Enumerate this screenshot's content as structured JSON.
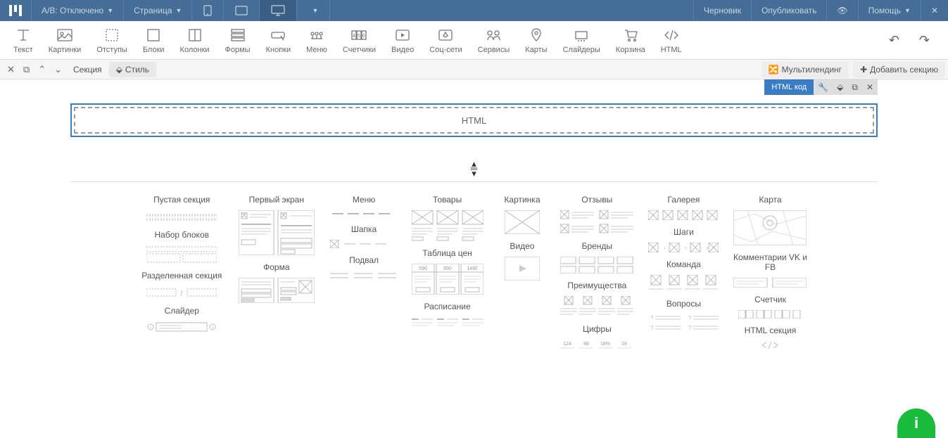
{
  "topbar": {
    "ab_label": "A/B: Отключено",
    "page_label": "Страница",
    "draft_label": "Черновик",
    "publish_label": "Опубликовать",
    "help_label": "Помощь"
  },
  "toolbar": {
    "text": "Текст",
    "images": "Картинки",
    "padding": "Отступы",
    "blocks": "Блоки",
    "columns": "Колонки",
    "forms": "Формы",
    "buttons": "Кнопки",
    "menu": "Меню",
    "counters": "Счетчики",
    "video": "Видео",
    "social": "Соц-сети",
    "services": "Сервисы",
    "maps": "Карты",
    "sliders": "Слайдеры",
    "cart": "Корзина",
    "html": "HTML"
  },
  "sectionbar": {
    "section": "Секция",
    "style": "Стиль",
    "multi": "Мультилендинг",
    "add": "Добавить секцию"
  },
  "element": {
    "badge": "HTML код",
    "placeholder": "HTML"
  },
  "templates": {
    "col1": [
      "Пустая секция",
      "Набор блоков",
      "Разделенная секция",
      "Слайдер"
    ],
    "col2": [
      "Первый экран",
      "Форма"
    ],
    "col3": [
      "Меню",
      "Шапка",
      "Подвал"
    ],
    "col4": [
      "Товары",
      "Таблица цен",
      "Расписание"
    ],
    "col5": [
      "Картинка",
      "Видео"
    ],
    "col6": [
      "Отзывы",
      "Бренды",
      "Преимущества",
      "Цифры"
    ],
    "col7": [
      "Галерея",
      "Шаги",
      "Команда",
      "Вопросы"
    ],
    "col8": [
      "Карта",
      "Комментарии VK и FB",
      "Счетчик",
      "HTML секция"
    ],
    "price_cells": [
      "590",
      "890",
      "1490"
    ],
    "numbers": [
      "124",
      "88",
      "18%",
      "18"
    ]
  },
  "help_fab": "i"
}
